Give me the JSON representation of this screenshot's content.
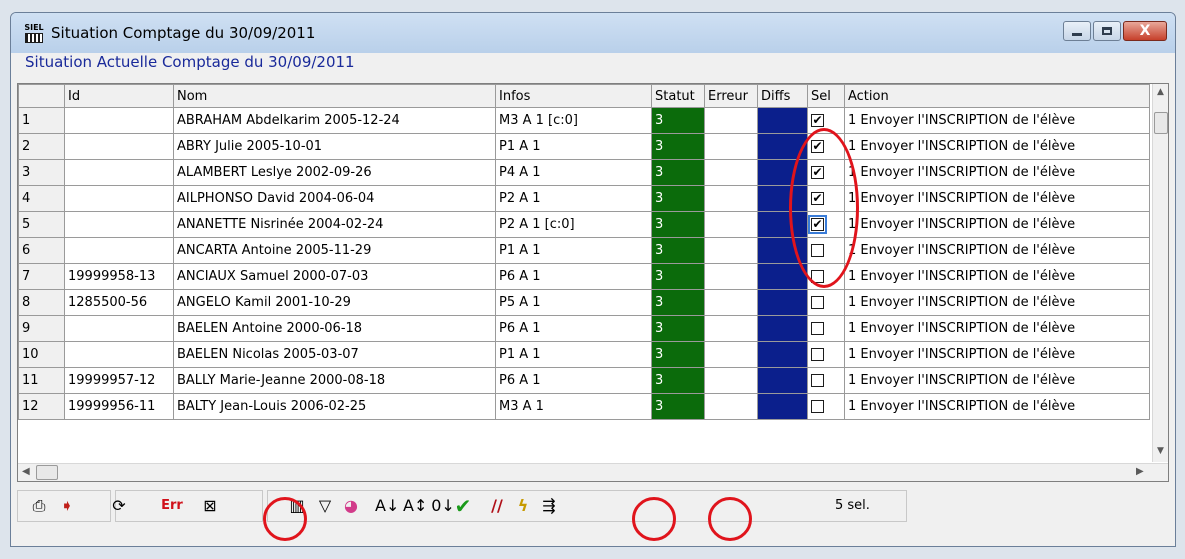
{
  "window": {
    "title": "Situation Comptage du 30/09/2011",
    "app_icon_text": "SIEL",
    "close_glyph": "X"
  },
  "subtitle": "Situation Actuelle Comptage du 30/09/2011",
  "table": {
    "columns": [
      "",
      "Id",
      "Nom",
      "Infos",
      "Statut",
      "Erreur",
      "Diffs",
      "Sel",
      "Action"
    ],
    "rows": [
      {
        "num": "1",
        "id": "",
        "nom": "ABRAHAM Abdelkarim 2005-12-24",
        "infos": "M3 A 1 [c:0]",
        "statut": "3",
        "erreur": "",
        "checked": true,
        "action": "1 Envoyer l'INSCRIPTION de l'élève"
      },
      {
        "num": "2",
        "id": "",
        "nom": "ABRY Julie 2005-10-01",
        "infos": "P1 A 1",
        "statut": "3",
        "erreur": "",
        "checked": true,
        "action": "1 Envoyer l'INSCRIPTION de l'élève"
      },
      {
        "num": "3",
        "id": "",
        "nom": "ALAMBERT Leslye 2002-09-26",
        "infos": "P4 A 1",
        "statut": "3",
        "erreur": "",
        "checked": true,
        "action": "1 Envoyer l'INSCRIPTION de l'élève"
      },
      {
        "num": "4",
        "id": "",
        "nom": "AILPHONSO David 2004-06-04",
        "infos": "P2 A 1",
        "statut": "3",
        "erreur": "",
        "checked": true,
        "action": "1 Envoyer l'INSCRIPTION de l'élève"
      },
      {
        "num": "5",
        "id": "",
        "nom": "ANANETTE Nisrinée 2004-02-24",
        "infos": "P2 A 1 [c:0]",
        "statut": "3",
        "erreur": "",
        "checked": true,
        "action": "1 Envoyer l'INSCRIPTION de l'élève"
      },
      {
        "num": "6",
        "id": "",
        "nom": "ANCARTA Antoine 2005-11-29",
        "infos": "P1 A 1",
        "statut": "3",
        "erreur": "",
        "checked": false,
        "action": "1 Envoyer l'INSCRIPTION de l'élève"
      },
      {
        "num": "7",
        "id": "19999958-13",
        "nom": "ANCIAUX Samuel 2000-07-03",
        "infos": "P6 A 1",
        "statut": "3",
        "erreur": "",
        "checked": false,
        "action": "1 Envoyer l'INSCRIPTION de l'élève"
      },
      {
        "num": "8",
        "id": "1285500-56",
        "nom": "ANGELO Kamil 2001-10-29",
        "infos": "P5 A 1",
        "statut": "3",
        "erreur": "",
        "checked": false,
        "action": "1 Envoyer l'INSCRIPTION de l'élève"
      },
      {
        "num": "9",
        "id": "",
        "nom": "BAELEN Antoine 2000-06-18",
        "infos": "P6 A 1",
        "statut": "3",
        "erreur": "",
        "checked": false,
        "action": "1 Envoyer l'INSCRIPTION de l'élève"
      },
      {
        "num": "10",
        "id": "",
        "nom": "BAELEN Nicolas 2005-03-07",
        "infos": "P1 A 1",
        "statut": "3",
        "erreur": "",
        "checked": false,
        "action": "1 Envoyer l'INSCRIPTION de l'élève"
      },
      {
        "num": "11",
        "id": "19999957-12",
        "nom": "BALLY Marie-Jeanne 2000-08-18",
        "infos": "P6 A 1",
        "statut": "3",
        "erreur": "",
        "checked": false,
        "action": "1 Envoyer l'INSCRIPTION de l'élève"
      },
      {
        "num": "12",
        "id": "19999956-11",
        "nom": "BALTY Jean-Louis 2006-02-25",
        "infos": "M3 A 1",
        "statut": "3",
        "erreur": "",
        "checked": false,
        "action": "1 Envoyer l'INSCRIPTION de l'élève"
      }
    ]
  },
  "toolbar": {
    "items": [
      {
        "name": "print-icon",
        "glyph": "⎙"
      },
      {
        "name": "export-icon",
        "glyph": "➧"
      },
      {
        "name": "refresh-icon",
        "glyph": "⟳"
      },
      {
        "name": "errors-icon",
        "glyph": "Err"
      },
      {
        "name": "import-icon",
        "glyph": "⊠"
      },
      {
        "name": "columns-icon",
        "glyph": "▥"
      },
      {
        "name": "filter-icon",
        "glyph": "▽"
      },
      {
        "name": "colors-icon",
        "glyph": "◕"
      },
      {
        "name": "sort-az-icon",
        "glyph": "A↓"
      },
      {
        "name": "sort-custom-icon",
        "glyph": "A↕"
      },
      {
        "name": "sort-09-icon",
        "glyph": "0↓"
      },
      {
        "name": "validate-icon",
        "glyph": "✔"
      },
      {
        "name": "cancel-icon",
        "glyph": "//"
      },
      {
        "name": "execute-icon",
        "glyph": "ϟ"
      },
      {
        "name": "send-icon",
        "glyph": "⇶"
      }
    ],
    "selection_count": "5 sel."
  },
  "colors": {
    "statut_bg": "#0b6b0b",
    "diffs_bg": "#0b1f8c",
    "annotation": "#e0141c",
    "subtitle": "#1a2a9a"
  }
}
